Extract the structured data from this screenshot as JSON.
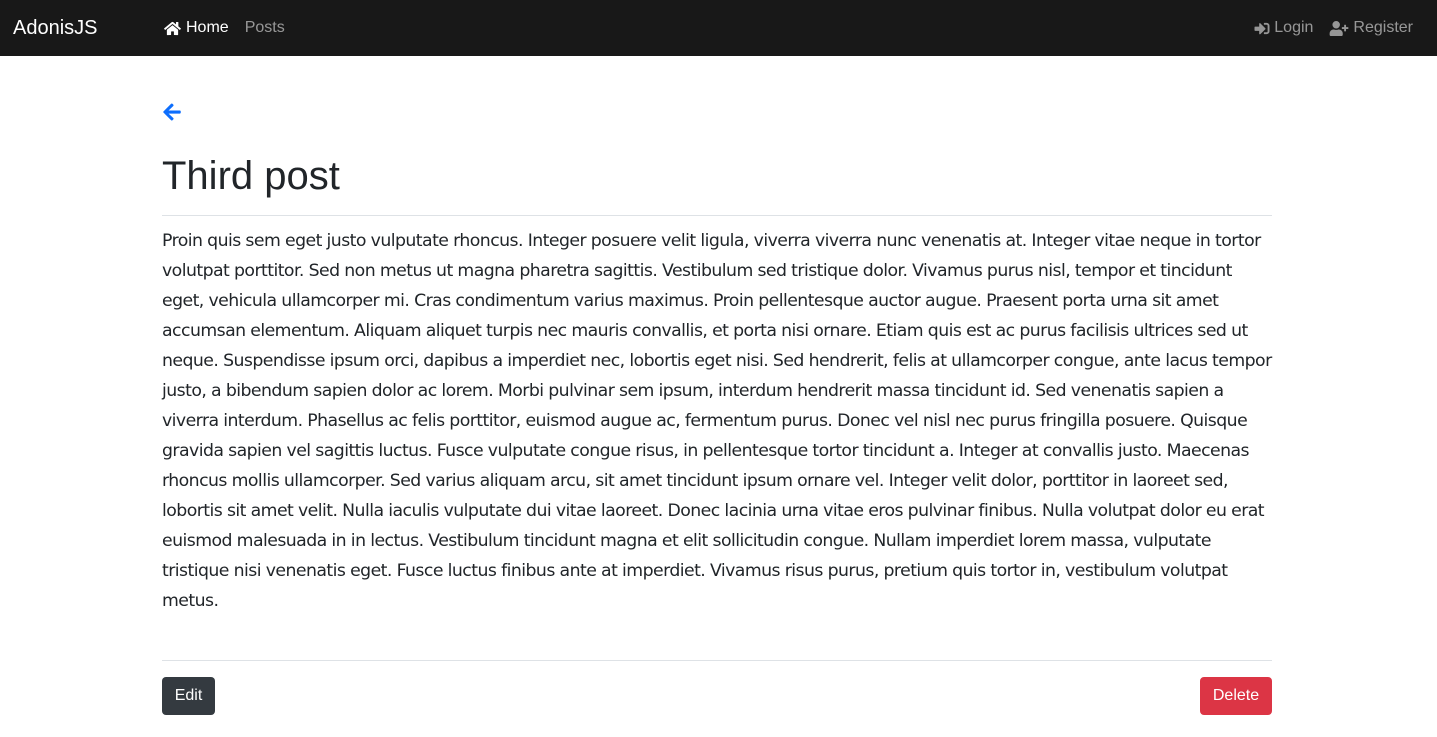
{
  "navbar": {
    "brand": "AdonisJS",
    "left_links": [
      {
        "label": "Home",
        "icon": "home-icon",
        "active": true
      },
      {
        "label": "Posts",
        "icon": null,
        "active": false
      }
    ],
    "right_links": [
      {
        "label": "Login",
        "icon": "sign-in-icon"
      },
      {
        "label": "Register",
        "icon": "user-plus-icon"
      }
    ]
  },
  "post": {
    "back_icon": "arrow-left-icon",
    "title": "Third post",
    "body": "Proin quis sem eget justo vulputate rhoncus. Integer posuere velit ligula, viverra viverra nunc venenatis at. Integer vitae neque in tortor volutpat porttitor. Sed non metus ut magna pharetra sagittis. Vestibulum sed tristique dolor. Vivamus purus nisl, tempor et tincidunt eget, vehicula ullamcorper mi. Cras condimentum varius maximus. Proin pellentesque auctor augue. Praesent porta urna sit amet accumsan elementum. Aliquam aliquet turpis nec mauris convallis, et porta nisi ornare. Etiam quis est ac purus facilisis ultrices sed ut neque. Suspendisse ipsum orci, dapibus a imperdiet nec, lobortis eget nisi. Sed hendrerit, felis at ullamcorper congue, ante lacus tempor justo, a bibendum sapien dolor ac lorem. Morbi pulvinar sem ipsum, interdum hendrerit massa tincidunt id. Sed venenatis sapien a viverra interdum. Phasellus ac felis porttitor, euismod augue ac, fermentum purus. Donec vel nisl nec purus fringilla posuere. Quisque gravida sapien vel sagittis luctus. Fusce vulputate congue risus, in pellentesque tortor tincidunt a. Integer at convallis justo. Maecenas rhoncus mollis ullamcorper. Sed varius aliquam arcu, sit amet tincidunt ipsum ornare vel. Integer velit dolor, porttitor in laoreet sed, lobortis sit amet velit. Nulla iaculis vulputate dui vitae laoreet. Donec lacinia urna vitae eros pulvinar finibus. Nulla volutpat dolor eu erat euismod malesuada in in lectus. Vestibulum tincidunt magna et elit sollicitudin congue. Nullam imperdiet lorem massa, vulputate tristique nisi venenatis eget. Fusce luctus finibus ante at imperdiet. Vivamus risus purus, pretium quis tortor in, vestibulum volutpat metus."
  },
  "actions": {
    "edit_label": "Edit",
    "delete_label": "Delete"
  },
  "colors": {
    "navbar_bg": "#181818",
    "link_blue": "#0d6efd",
    "edit_bg": "#343a40",
    "delete_bg": "#dc3545"
  }
}
